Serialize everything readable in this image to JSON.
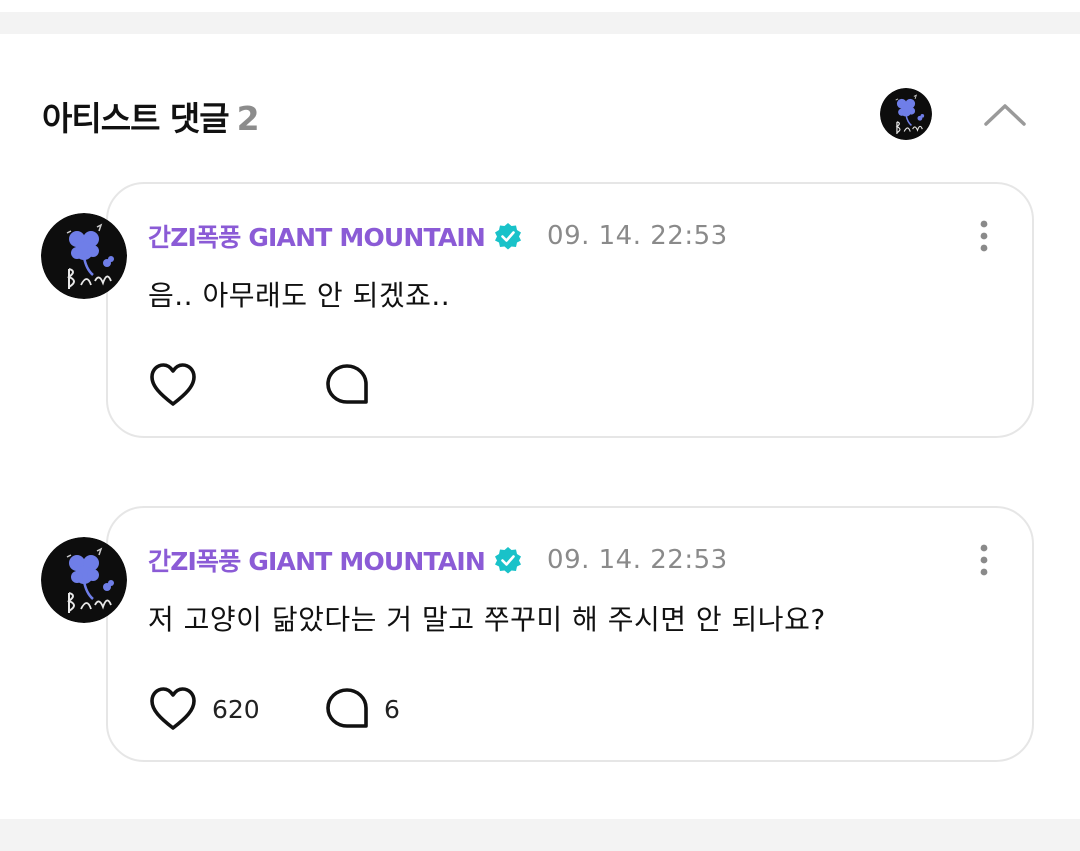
{
  "section": {
    "title": "아티스트 댓글",
    "count": "2"
  },
  "comments": [
    {
      "author": "간ZI폭풍 GIANT MOUNTAIN",
      "time": "09. 14. 22:53",
      "text": "음.. 아무래도 안 되겠죠..",
      "likes": "",
      "replies": ""
    },
    {
      "author": "간ZI폭풍 GIANT MOUNTAIN",
      "time": "09. 14. 22:53",
      "text": "저 고양이 닮았다는 거 말고 쭈꾸미 해 주시면 안 되나요?",
      "likes": "620",
      "replies": "6"
    }
  ],
  "colors": {
    "author": "#8b5bd6",
    "verified": "#19c2c9",
    "border": "#e6e6e6"
  },
  "icons": [
    "clover-avatar",
    "chevron-up-icon",
    "verified-badge-icon",
    "more-vertical-icon",
    "heart-icon",
    "comment-bubble-icon"
  ]
}
